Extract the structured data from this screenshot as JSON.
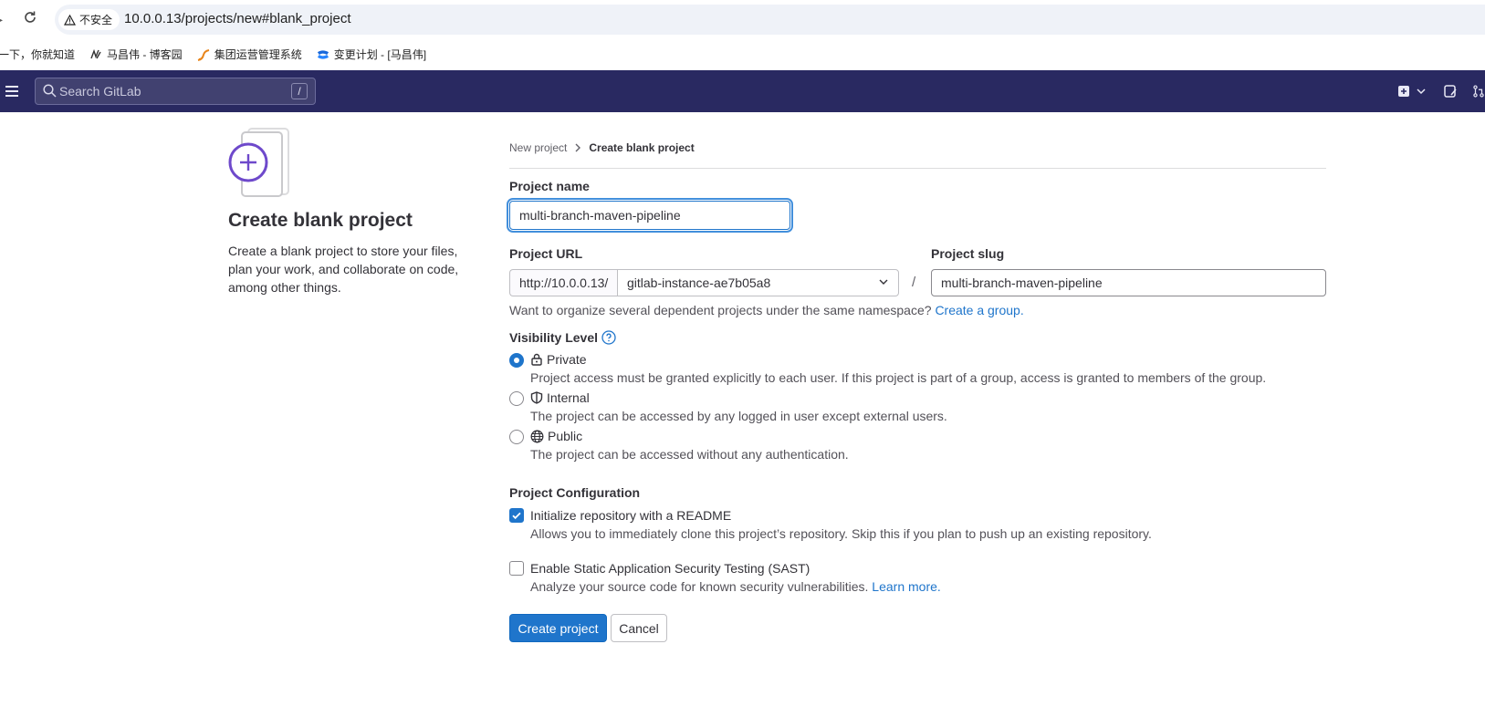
{
  "browser": {
    "insecure_label": "不安全",
    "url": "10.0.0.13/projects/new#blank_project",
    "bookmarks": [
      {
        "label": "一下，你就知道",
        "icon": "baidu-icon"
      },
      {
        "label": "马昌伟 - 博客园",
        "icon": "cnblogs-icon"
      },
      {
        "label": "集团运营管理系统",
        "icon": "ops-icon"
      },
      {
        "label": "变更计划 - [马昌伟]",
        "icon": "confluence-icon"
      }
    ]
  },
  "topbar": {
    "search_placeholder": "Search GitLab",
    "search_shortcut": "/",
    "icons": [
      "new-menu-icon",
      "chevron-down-icon",
      "issues-icon",
      "merge-requests-icon"
    ]
  },
  "left": {
    "title": "Create blank project",
    "description": "Create a blank project to store your files, plan your work, and collaborate on code, among other things."
  },
  "breadcrumb": {
    "parent": "New project",
    "current": "Create blank project"
  },
  "form": {
    "project_name_label": "Project name",
    "project_name_value": "multi-branch-maven-pipeline",
    "project_url_label": "Project URL",
    "url_prefix": "http://10.0.0.13/",
    "namespace": "gitlab-instance-ae7b05a8",
    "slash": "/",
    "project_slug_label": "Project slug",
    "project_slug_value": "multi-branch-maven-pipeline",
    "namespace_help": "Want to organize several dependent projects under the same namespace?",
    "namespace_help_link": "Create a group.",
    "visibility_label": "Visibility Level",
    "visibility_options": [
      {
        "label": "Private",
        "icon": "lock-icon",
        "description": "Project access must be granted explicitly to each user. If this project is part of a group, access is granted to members of the group.",
        "checked": true
      },
      {
        "label": "Internal",
        "icon": "shield-icon",
        "description": "The project can be accessed by any logged in user except external users.",
        "checked": false
      },
      {
        "label": "Public",
        "icon": "globe-icon",
        "description": "The project can be accessed without any authentication.",
        "checked": false
      }
    ],
    "config_label": "Project Configuration",
    "readme_label": "Initialize repository with a README",
    "readme_help": "Allows you to immediately clone this project’s repository. Skip this if you plan to push up an existing repository.",
    "readme_checked": true,
    "sast_label": "Enable Static Application Security Testing (SAST)",
    "sast_help": "Analyze your source code for known security vulnerabilities.",
    "sast_help_link": "Learn more.",
    "sast_checked": false,
    "create_button": "Create project",
    "cancel_button": "Cancel"
  },
  "colors": {
    "topbar": "#292961",
    "primary": "#1f75cb",
    "accent_purple": "#6e49cb"
  }
}
